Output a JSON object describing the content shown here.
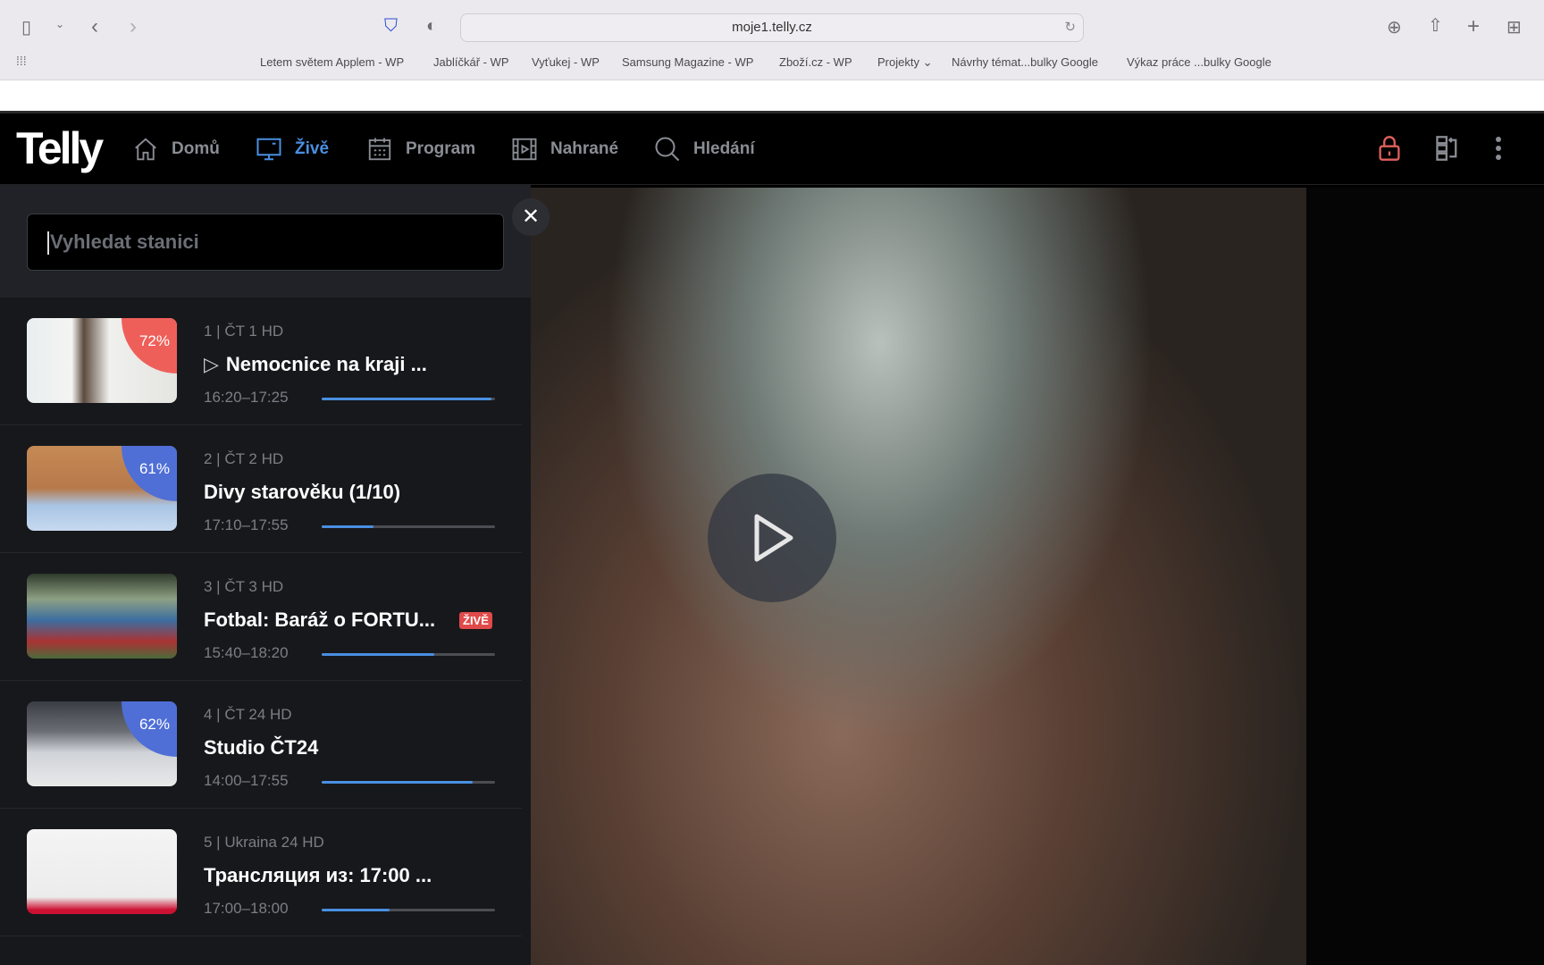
{
  "browser": {
    "url": "moje1.telly.cz",
    "bookmarks": [
      "Letem světem Applem - WP",
      "Jablíčkář - WP",
      "Vyťukej - WP",
      "Samsung Magazine - WP",
      "Zboží.cz - WP",
      "Projekty ⌄",
      "Návrhy témat...bulky Google",
      "Výkaz práce ...bulky Google"
    ]
  },
  "nav": {
    "logo": "Telly",
    "items": [
      {
        "label": "Domů"
      },
      {
        "label": "Živě"
      },
      {
        "label": "Program"
      },
      {
        "label": "Nahrané"
      },
      {
        "label": "Hledání"
      }
    ]
  },
  "search": {
    "placeholder": "Vyhledat stanici"
  },
  "colors": {
    "accent": "#4a8fe2",
    "badge_red": "#ef5f5a",
    "badge_blue": "#4f6fd6",
    "live": "#e04a4a"
  },
  "channels": [
    {
      "channel": "1 | ČT 1 HD",
      "title": "Nemocnice na kraji ...",
      "time": "16:20–17:25",
      "progress": 0.98,
      "rating": "72%",
      "rating_color": "#ef5f5a",
      "playing": true
    },
    {
      "channel": "2 | ČT 2 HD",
      "title": "Divy starověku (1/10)",
      "time": "17:10–17:55",
      "progress": 0.3,
      "rating": "61%",
      "rating_color": "#4f6fd6"
    },
    {
      "channel": "3 | ČT 3 HD",
      "title": "Fotbal: Baráž o FORTU...",
      "time": "15:40–18:20",
      "progress": 0.65,
      "live": "ŽIVĚ"
    },
    {
      "channel": "4 | ČT 24 HD",
      "title": "Studio ČT24",
      "time": "14:00–17:55",
      "progress": 0.87,
      "rating": "62%",
      "rating_color": "#4f6fd6"
    },
    {
      "channel": "5 | Ukraina 24 HD",
      "title": "Трансляция из: 17:00 ...",
      "time": "17:00–18:00",
      "progress": 0.39
    }
  ]
}
